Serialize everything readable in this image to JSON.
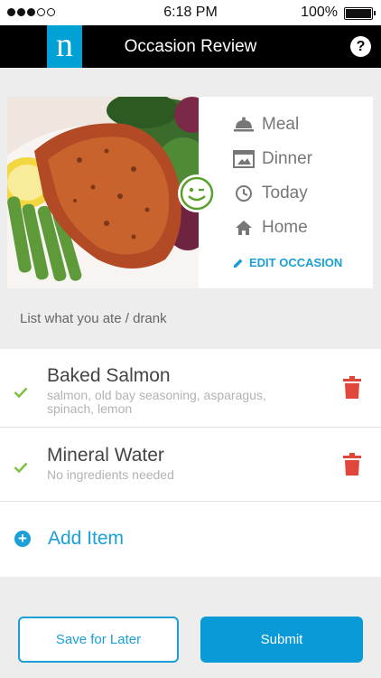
{
  "status_bar": {
    "time": "6:18 PM",
    "battery": "100%",
    "signal_bars": 3,
    "signal_total": 5
  },
  "nav": {
    "logo_letter": "n",
    "title": "Occasion Review",
    "help_label": "?"
  },
  "occasion": {
    "photo_icon": "food-photo",
    "details": [
      {
        "icon": "cloche-icon",
        "label": "Meal"
      },
      {
        "icon": "oven-icon",
        "label": "Dinner"
      },
      {
        "icon": "clock-icon",
        "label": "Today"
      },
      {
        "icon": "home-icon",
        "label": "Home"
      }
    ],
    "edit_label": "EDIT OCCASION",
    "mood_icon": "smiley-icon"
  },
  "prompt": "List what you ate / drank",
  "items": [
    {
      "name": "Baked Salmon",
      "ingredients": "salmon, old bay seasoning, asparagus, spinach, lemon"
    },
    {
      "name": "Mineral Water",
      "ingredients": "No ingredients needed"
    }
  ],
  "add_item_label": "Add Item",
  "buttons": {
    "save_later": "Save for Later",
    "submit": "Submit"
  },
  "colors": {
    "accent": "#1a9fd6",
    "delete": "#e0463a",
    "check": "#7cc242",
    "nav_bg": "#000000"
  }
}
